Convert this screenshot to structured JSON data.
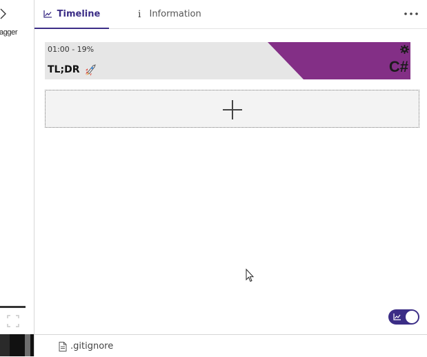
{
  "left_panel": {
    "clipped_text": "agger",
    "chevron_icon": "chevron-right-icon",
    "expand_icon": "expand-icon"
  },
  "tabs": [
    {
      "label": "Timeline",
      "icon": "chart-line-icon",
      "active": true
    },
    {
      "label": "Information",
      "icon": "info-icon",
      "active": false
    }
  ],
  "more_icon": "ellipsis-icon",
  "card": {
    "meta": "01:00 - 19%",
    "title": "TL;DR",
    "emoji_icon": "rocket-icon",
    "language": "C#",
    "gear_icon": "gear-icon",
    "accent_color": "#832f86"
  },
  "add_button_icon": "plus-icon",
  "toggle": {
    "on": true,
    "icon": "chart-line-icon",
    "color": "#3b2d86"
  },
  "bottom_file": {
    "name": ".gitignore",
    "icon": "file-icon"
  }
}
